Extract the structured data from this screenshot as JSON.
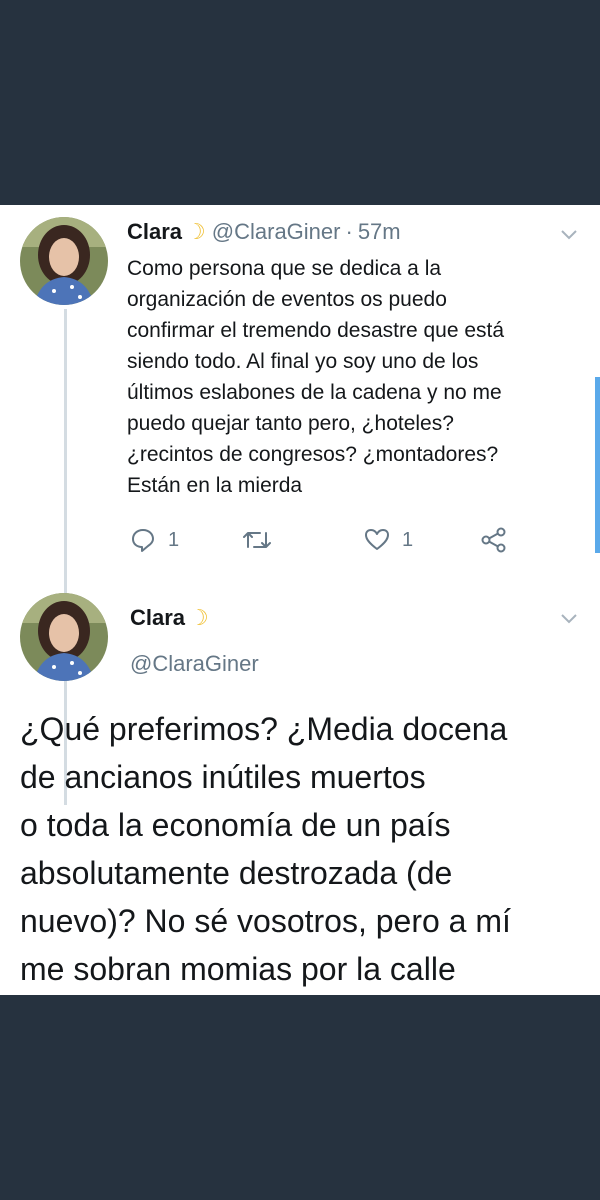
{
  "tweet1": {
    "author_name": "Clara",
    "handle": "@ClaraGiner",
    "separator": "·",
    "time": "57m",
    "text_lines": [
      "Como persona que se dedica a la",
      "organización de eventos os puedo",
      "confirmar el tremendo desastre que está",
      "siendo todo. Al final yo soy uno de los",
      "últimos eslabones de la cadena y no me",
      "puedo quejar tanto pero, ¿hoteles?",
      "¿recintos de congresos? ¿montadores?",
      "Están en la mierda"
    ],
    "reply_count": "1",
    "like_count": "1"
  },
  "tweet2": {
    "author_name": "Clara",
    "handle": "@ClaraGiner",
    "text_lines": [
      "¿Qué preferimos? ¿Media docena",
      "de ancianos inútiles muertos",
      "o toda la economía de un país",
      "absolutamente destrozada (de",
      "nuevo)? No sé vosotros, pero a mí",
      "me sobran momias por la calle"
    ]
  },
  "icons": {
    "moon": "crescent-moon-icon",
    "reply": "reply-icon",
    "retweet": "retweet-icon",
    "like": "heart-icon",
    "share": "share-icon",
    "chevron": "chevron-down-icon"
  },
  "colors": {
    "background": "#26323f",
    "card": "#ffffff",
    "text": "#14171a",
    "secondary_text": "#657786",
    "thread_line": "#d4dce2",
    "moon": "#f0c23a",
    "scroll_indicator": "#5aa9ea"
  }
}
